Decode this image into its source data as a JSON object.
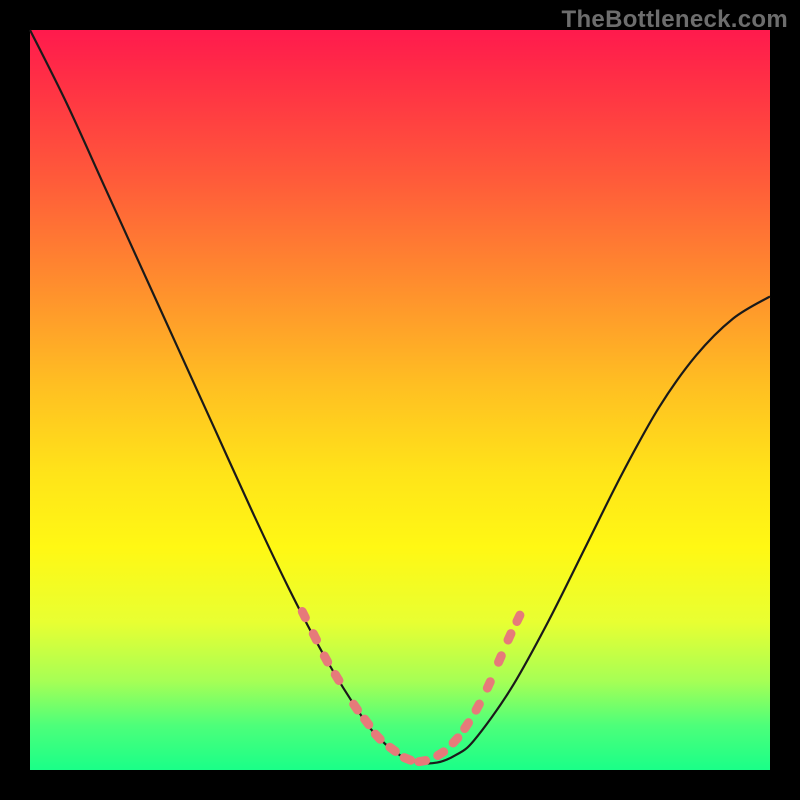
{
  "watermark": "TheBottleneck.com",
  "chart_data": {
    "type": "line",
    "title": "",
    "xlabel": "",
    "ylabel": "",
    "xlim": [
      0,
      1
    ],
    "ylim": [
      0,
      1
    ],
    "curve": {
      "x": [
        0.0,
        0.05,
        0.1,
        0.15,
        0.2,
        0.25,
        0.3,
        0.35,
        0.4,
        0.45,
        0.475,
        0.5,
        0.525,
        0.55,
        0.575,
        0.6,
        0.65,
        0.7,
        0.75,
        0.8,
        0.85,
        0.9,
        0.95,
        1.0
      ],
      "y": [
        1.0,
        0.9,
        0.79,
        0.68,
        0.57,
        0.46,
        0.35,
        0.245,
        0.15,
        0.07,
        0.04,
        0.02,
        0.01,
        0.01,
        0.02,
        0.04,
        0.11,
        0.2,
        0.3,
        0.4,
        0.49,
        0.56,
        0.61,
        0.64
      ]
    },
    "markers": {
      "x": [
        0.37,
        0.385,
        0.4,
        0.415,
        0.44,
        0.455,
        0.47,
        0.49,
        0.51,
        0.53,
        0.555,
        0.575,
        0.59,
        0.605,
        0.62,
        0.635,
        0.648,
        0.66
      ],
      "y": [
        0.21,
        0.18,
        0.15,
        0.125,
        0.085,
        0.065,
        0.045,
        0.028,
        0.015,
        0.012,
        0.022,
        0.04,
        0.06,
        0.085,
        0.115,
        0.15,
        0.18,
        0.205
      ]
    },
    "gradient_stops": [
      {
        "pos": 0.0,
        "color": "#ff1a4d"
      },
      {
        "pos": 0.2,
        "color": "#ff5a3a"
      },
      {
        "pos": 0.48,
        "color": "#ffbf22"
      },
      {
        "pos": 0.7,
        "color": "#fff814"
      },
      {
        "pos": 0.88,
        "color": "#a6ff55"
      },
      {
        "pos": 1.0,
        "color": "#1aff88"
      }
    ]
  }
}
